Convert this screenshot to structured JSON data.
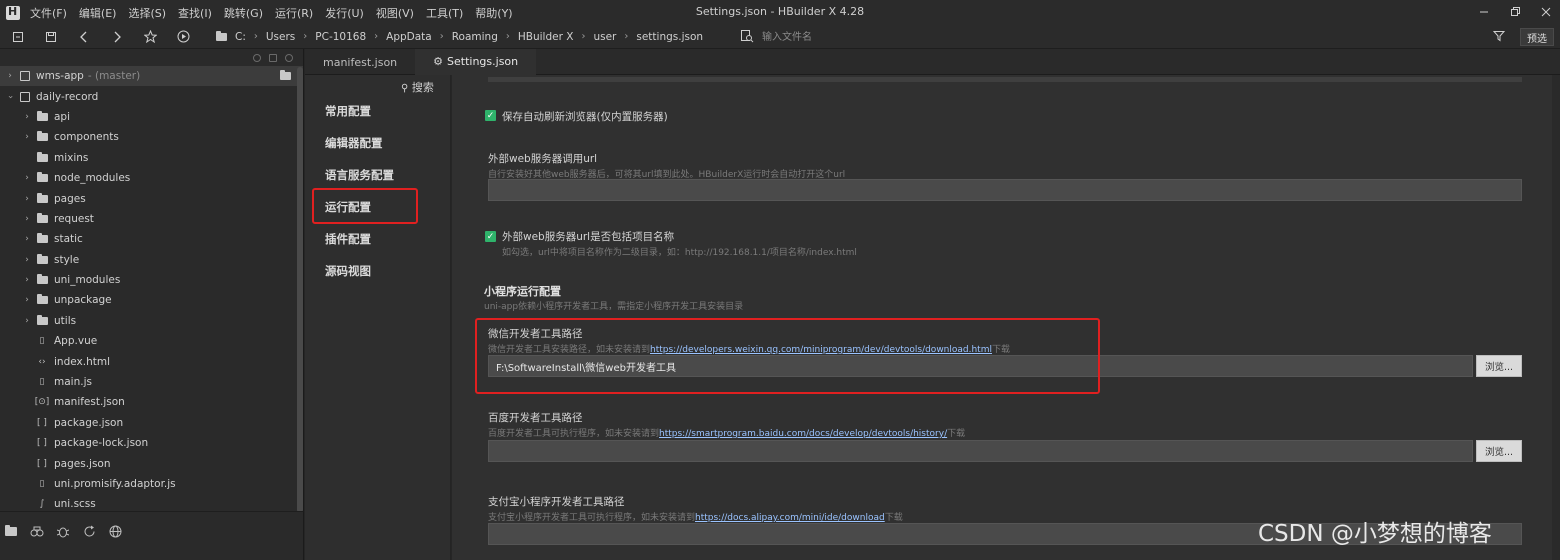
{
  "menubar": {
    "items": [
      "文件(F)",
      "编辑(E)",
      "选择(S)",
      "查找(I)",
      "跳转(G)",
      "运行(R)",
      "发行(U)",
      "视图(V)",
      "工具(T)",
      "帮助(Y)"
    ],
    "window_title": "Settings.json - HBuilder X 4.28"
  },
  "toolbar": {
    "breadcrumbs": [
      "C:",
      "Users",
      "PC-10168",
      "AppData",
      "Roaming",
      "HBuilder X",
      "user",
      "settings.json"
    ],
    "file_input_placeholder": "输入文件名",
    "preview_label": "预选"
  },
  "tree": {
    "projects": [
      {
        "name": "wms-app",
        "branch": "- (master)"
      },
      {
        "name": "daily-record"
      }
    ],
    "items": [
      {
        "label": "api",
        "type": "folder",
        "expandable": true
      },
      {
        "label": "components",
        "type": "folder",
        "expandable": true
      },
      {
        "label": "mixins",
        "type": "folder-open",
        "expandable": false
      },
      {
        "label": "node_modules",
        "type": "folder",
        "expandable": true
      },
      {
        "label": "pages",
        "type": "folder",
        "expandable": true
      },
      {
        "label": "request",
        "type": "folder",
        "expandable": true
      },
      {
        "label": "static",
        "type": "folder",
        "expandable": true
      },
      {
        "label": "style",
        "type": "folder",
        "expandable": true
      },
      {
        "label": "uni_modules",
        "type": "folder",
        "expandable": true
      },
      {
        "label": "unpackage",
        "type": "folder",
        "expandable": true
      },
      {
        "label": "utils",
        "type": "folder",
        "expandable": true
      },
      {
        "label": "App.vue",
        "type": "vue",
        "expandable": false
      },
      {
        "label": "index.html",
        "type": "html",
        "expandable": false
      },
      {
        "label": "main.js",
        "type": "js",
        "expandable": false
      },
      {
        "label": "manifest.json",
        "type": "manifest",
        "expandable": false
      },
      {
        "label": "package.json",
        "type": "json",
        "expandable": false
      },
      {
        "label": "package-lock.json",
        "type": "json",
        "expandable": false
      },
      {
        "label": "pages.json",
        "type": "json",
        "expandable": false
      },
      {
        "label": "uni.promisify.adaptor.js",
        "type": "js",
        "expandable": false
      },
      {
        "label": "uni.scss",
        "type": "scss",
        "expandable": false
      }
    ]
  },
  "tabs": [
    {
      "label": "manifest.json",
      "active": false
    },
    {
      "label": "Settings.json",
      "active": true
    }
  ],
  "settings_nav": {
    "search_label": "搜索",
    "items": [
      "常用配置",
      "编辑器配置",
      "语言服务配置",
      "运行配置",
      "插件配置",
      "源码视图"
    ],
    "active_index": 3
  },
  "content": {
    "auto_refresh_label": "保存自动刷新浏览器(仅内置服务器)",
    "ext_server_label": "外部web服务器调用url",
    "ext_server_hint": "自行安装好其他web服务器后，可将其url填到此处。HBuilderX运行时会自动打开这个url",
    "ext_server_value": "",
    "include_project_label": "外部web服务器url是否包括项目名称",
    "include_project_hint": "如勾选，url中将项目名称作为二级目录，如：http://192.168.1.1/项目名称/index.html",
    "mp_section_title": "小程序运行配置",
    "mp_section_hint": "uni-app依赖小程序开发者工具，需指定小程序开发工具安装目录",
    "wechat": {
      "label": "微信开发者工具路径",
      "hint_prefix": "微信开发者工具安装路径，如未安装请到",
      "link": "https://developers.weixin.qq.com/miniprogram/dev/devtools/download.html",
      "hint_suffix": "下载",
      "value": "F:\\SoftwareInstall\\微信web开发者工具",
      "browse": "浏览..."
    },
    "baidu": {
      "label": "百度开发者工具路径",
      "hint_prefix": "百度开发者工具可执行程序，如未安装请到",
      "link": "https://smartprogram.baidu.com/docs/develop/devtools/history/",
      "hint_suffix": "下载",
      "value": "",
      "browse": "浏览..."
    },
    "alipay": {
      "label": "支付宝小程序开发者工具路径",
      "hint_prefix": "支付宝小程序开发者工具可执行程序，如未安装请到",
      "link": "https://docs.alipay.com/mini/ide/download",
      "hint_suffix": "下载",
      "value": ""
    }
  },
  "watermark": "CSDN @小梦想的博客",
  "colors": {
    "checkbox": "#2fb36b",
    "highlight": "#e02020",
    "link": "#9ac3ff"
  }
}
